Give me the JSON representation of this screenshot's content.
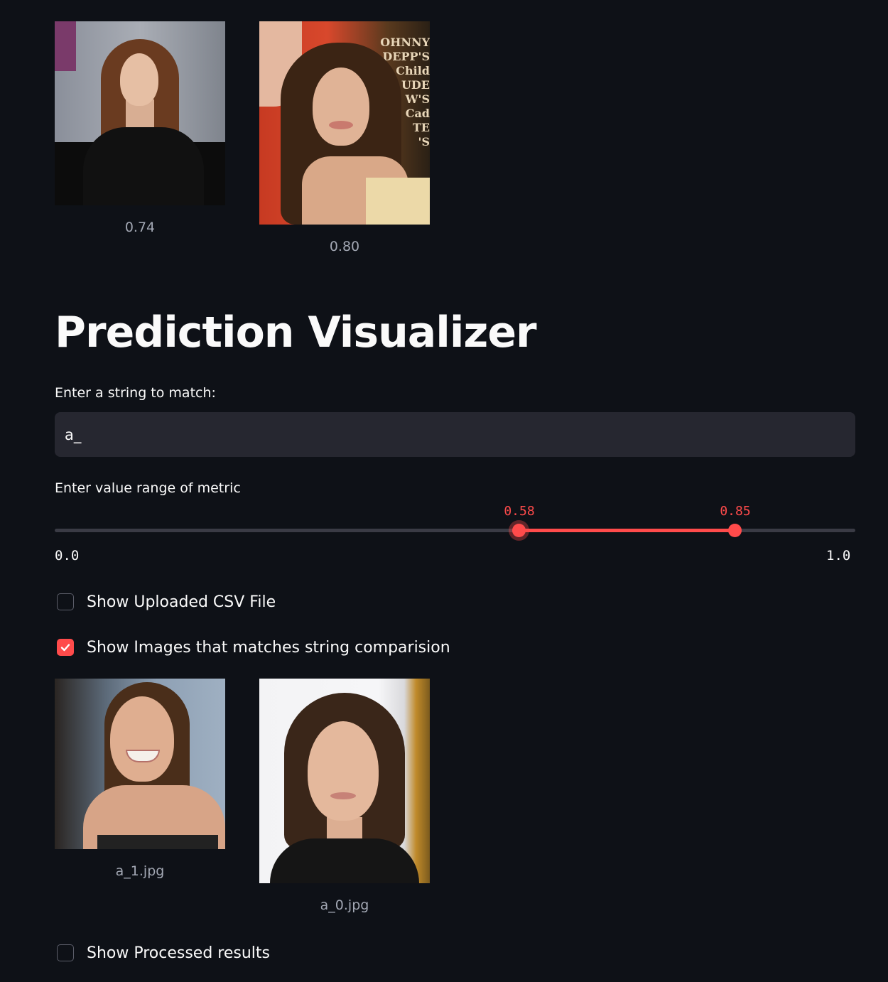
{
  "top_images": [
    {
      "caption": "0.74"
    },
    {
      "caption": "0.80"
    }
  ],
  "photo_poster_text": "OHNNY\nDEPP'S\nChild\nUDE\nW'S\nCad\nTE\n'S",
  "page_title": "Prediction Visualizer",
  "string_input": {
    "label": "Enter a string to match:",
    "value": "a_"
  },
  "range_slider": {
    "label": "Enter value range of metric",
    "min": 0.0,
    "max": 1.0,
    "min_label": "0.0",
    "max_label": "1.0",
    "low_value": 0.58,
    "high_value": 0.85,
    "low_label": "0.58",
    "high_label": "0.85",
    "accent_color": "#ff4b4b"
  },
  "checkboxes": {
    "show_csv": {
      "label": "Show Uploaded CSV File",
      "checked": false
    },
    "show_images": {
      "label": "Show Images that matches string comparision",
      "checked": true
    },
    "show_processed": {
      "label": "Show Processed results",
      "checked": false
    }
  },
  "matched_images": [
    {
      "caption": "a_1.jpg"
    },
    {
      "caption": "a_0.jpg"
    }
  ],
  "colors": {
    "background": "#0e1117",
    "accent": "#ff4b4b",
    "input_bg": "#262730"
  }
}
